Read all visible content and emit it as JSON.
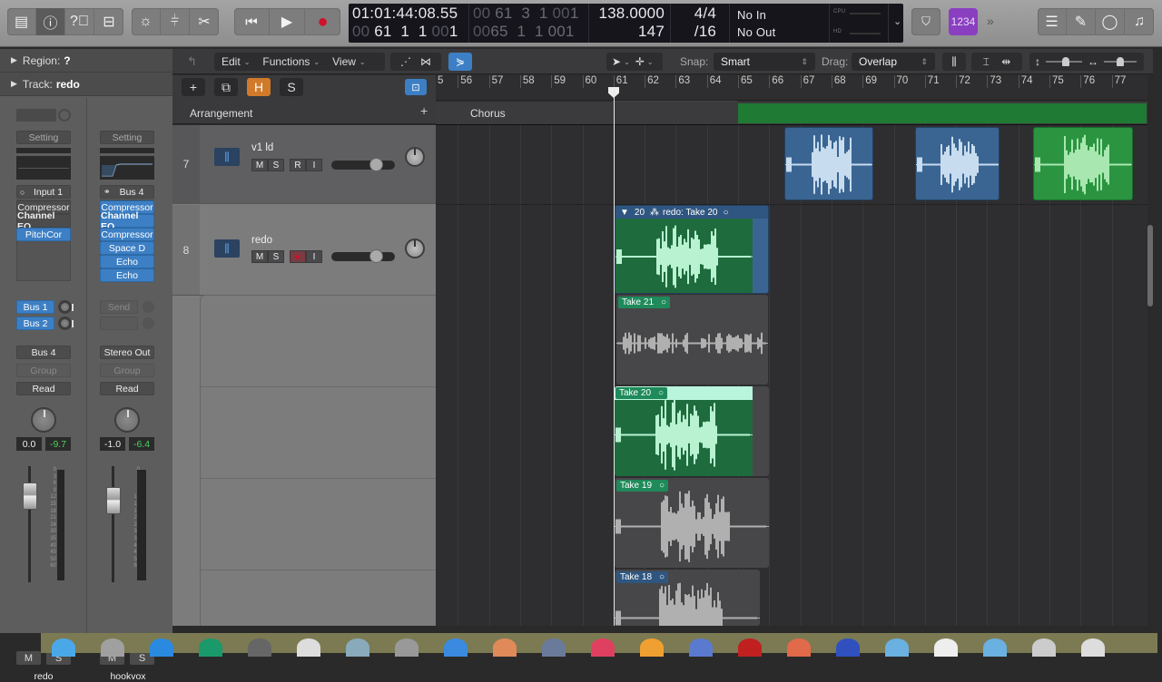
{
  "control_bar": {
    "left_buttons": [
      {
        "name": "library",
        "icon": "library-icon"
      },
      {
        "name": "inspector",
        "icon": "info-icon",
        "active": true
      },
      {
        "name": "quick-help",
        "icon": "help-icon"
      },
      {
        "name": "toolbar",
        "icon": "toolbar-icon"
      }
    ],
    "mid_buttons": [
      {
        "name": "smart-controls",
        "icon": "dial-icon"
      },
      {
        "name": "mixer",
        "icon": "mixer-icon"
      },
      {
        "name": "editors",
        "icon": "scissors-icon"
      }
    ],
    "transport": [
      {
        "name": "go-to-beginning",
        "glyph": "⏮"
      },
      {
        "name": "play",
        "glyph": "▶"
      },
      {
        "name": "record",
        "glyph": "●"
      }
    ],
    "lcd": {
      "smpte": "01:01:44:08.55",
      "bars_dim": "00",
      "bars": "61  1  1",
      "ticks_dim": "00",
      "ticks": "1",
      "cycle_start": "61  3  1",
      "cycle_start_dim_a": "00",
      "cycle_start_dim_b": "00",
      "cycle_start_tick": "1",
      "cycle_end": "65  1  1",
      "cycle_end_dim_a": "00",
      "cycle_end_tick": "001",
      "tempo": "138.0000",
      "bpm_sub": "147",
      "time_sig": "4/4",
      "division": "/16",
      "midi_in": "No In",
      "midi_out": "No Out",
      "cpu_label": "CPU",
      "hd_label": "HD"
    },
    "right": {
      "count_in_badge": "1234",
      "list_editors": "list-icon",
      "note_pad": "notepad-icon",
      "loop_browser": "loop-icon",
      "browsers": "media-icon"
    }
  },
  "inspector": {
    "region_label": "Region:",
    "region_value": "?",
    "track_label": "Track:",
    "track_value": "redo",
    "strips": [
      {
        "name": "redo",
        "setting": "Setting",
        "input": "Input 1",
        "plugins": [
          {
            "label": "Compressor",
            "active": false
          },
          {
            "label": "Channel EQ",
            "active": false
          },
          {
            "label": "PitchCor",
            "active": true
          }
        ],
        "sends": [
          "Bus 1",
          "Bus 2"
        ],
        "output": "Bus 4",
        "group": "Group",
        "automation": "Read",
        "volume": "0.0",
        "peak": "-9.7",
        "mute": "M",
        "solo": "S",
        "input_monitor": "I"
      },
      {
        "name": "hookvox",
        "setting": "Setting",
        "input": "Bus 4",
        "plugins": [
          {
            "label": "Compressor",
            "active": true
          },
          {
            "label": "Channel EQ",
            "active": true
          },
          {
            "label": "Compressor",
            "active": true
          },
          {
            "label": "Space D",
            "active": true
          },
          {
            "label": "Echo",
            "active": true
          },
          {
            "label": "Echo",
            "active": true
          }
        ],
        "sends": [
          "Send"
        ],
        "output": "Stereo Out",
        "group": "Group",
        "automation": "Read",
        "volume": "-1.0",
        "peak": "-6.4",
        "mute": "M",
        "solo": "S"
      }
    ],
    "meter_scale": [
      "0",
      "3",
      "6",
      "9",
      "12",
      "15",
      "18",
      "21",
      "24",
      "30",
      "35",
      "40",
      "45",
      "50",
      "60"
    ]
  },
  "toolbar": {
    "menus": [
      "Edit",
      "Functions",
      "View"
    ],
    "snap_label": "Snap:",
    "snap_value": "Smart",
    "drag_label": "Drag:",
    "drag_value": "Overlap"
  },
  "track_header": {
    "add": "+",
    "hide": "H",
    "solo": "S",
    "arrangement": "Arrangement",
    "arrangement_add": "+"
  },
  "ruler": {
    "bars": [
      "5",
      "56",
      "57",
      "58",
      "59",
      "60",
      "61",
      "62",
      "63",
      "64",
      "65",
      "66",
      "67",
      "68",
      "69",
      "70",
      "71",
      "72",
      "73",
      "74",
      "75",
      "76",
      "77"
    ]
  },
  "arrangement_markers": [
    {
      "label": "Chorus",
      "color": "#3b3b3d"
    },
    {
      "label": "",
      "color": "#1f7a34"
    }
  ],
  "tracks": [
    {
      "number": "7",
      "name": "v1 ld",
      "buttons": [
        "M",
        "S",
        "R",
        "I"
      ],
      "record_armed": false
    },
    {
      "number": "8",
      "name": "redo",
      "buttons": [
        "M",
        "S",
        "R",
        "I"
      ],
      "record_armed": true
    }
  ],
  "regions": {
    "track7": [
      {
        "color": "blue"
      },
      {
        "color": "blue"
      },
      {
        "color": "green"
      }
    ],
    "take_folder": {
      "count": "20",
      "title": "redo: Take 20",
      "takes": [
        {
          "label": "Take 21",
          "selected": false
        },
        {
          "label": "Take 20",
          "selected": true
        },
        {
          "label": "Take 19",
          "selected": false
        },
        {
          "label": "Take 18",
          "selected": false
        }
      ]
    }
  },
  "colors": {
    "record": "#d0112b",
    "accent_blue": "#3d7fc4",
    "region_green": "#1e6b3e",
    "take_green": "#1f8a5a",
    "hide_orange": "#d07a2a",
    "count_in_purple": "#8a3fc0"
  }
}
